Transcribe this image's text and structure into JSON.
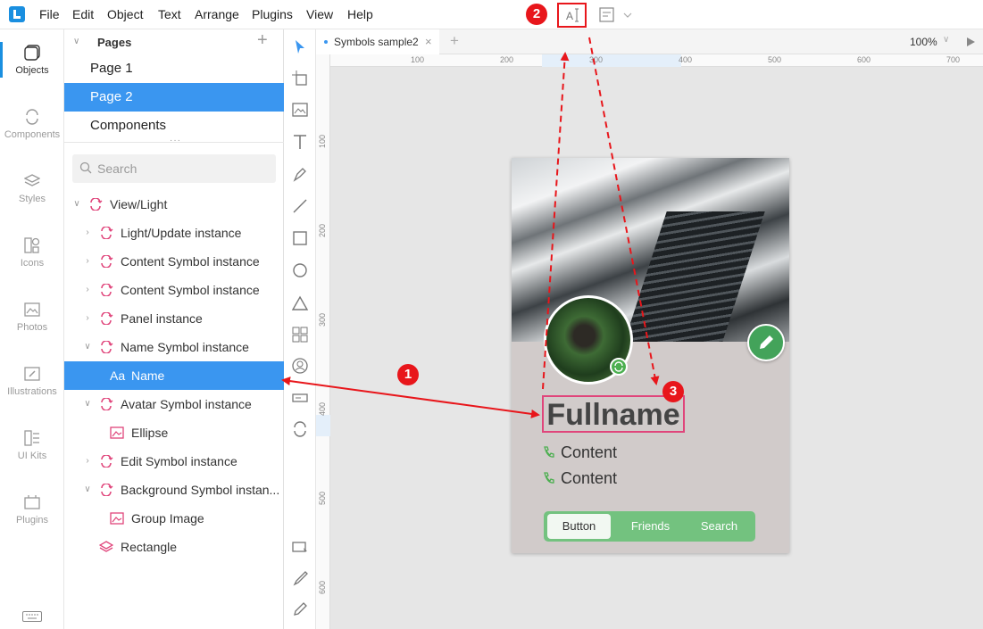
{
  "menubar": {
    "items": [
      "File",
      "Edit",
      "Object",
      "Text",
      "Arrange",
      "Plugins",
      "View",
      "Help"
    ]
  },
  "rail": {
    "items": [
      "Objects",
      "Components",
      "Styles",
      "Icons",
      "Photos",
      "Illustrations",
      "UI Kits",
      "Plugins"
    ]
  },
  "pages": {
    "title": "Pages",
    "items": [
      "Page 1",
      "Page 2",
      "Components"
    ],
    "selected": "Page 2"
  },
  "layers": {
    "search_placeholder": "Search",
    "items": [
      {
        "label": "View/Light"
      },
      {
        "label": "Light/Update instance"
      },
      {
        "label": "Content Symbol instance"
      },
      {
        "label": "Content Symbol instance"
      },
      {
        "label": "Panel instance"
      },
      {
        "label": "Name Symbol instance"
      },
      {
        "label": "Name"
      },
      {
        "label": "Avatar Symbol instance"
      },
      {
        "label": "Ellipse"
      },
      {
        "label": "Edit Symbol instance"
      },
      {
        "label": "Background Symbol instan..."
      },
      {
        "label": "Group Image"
      },
      {
        "label": "Rectangle"
      }
    ]
  },
  "document": {
    "tab": "Symbols sample2",
    "zoom": "100%"
  },
  "ruler": {
    "h": [
      "100",
      "200",
      "300",
      "400",
      "500",
      "600",
      "700"
    ],
    "v": [
      "100",
      "200",
      "300",
      "400",
      "500",
      "600"
    ]
  },
  "artboard": {
    "name": "Fullname",
    "contacts": [
      "Content",
      "Content"
    ],
    "tabbar": [
      "Button",
      "Friends",
      "Search"
    ]
  },
  "annotations": [
    "1",
    "2",
    "3"
  ],
  "colors": {
    "accent": "#3a96f0",
    "symbol": "#e0457b",
    "green": "#73c27f",
    "annotation": "#e8161b"
  }
}
